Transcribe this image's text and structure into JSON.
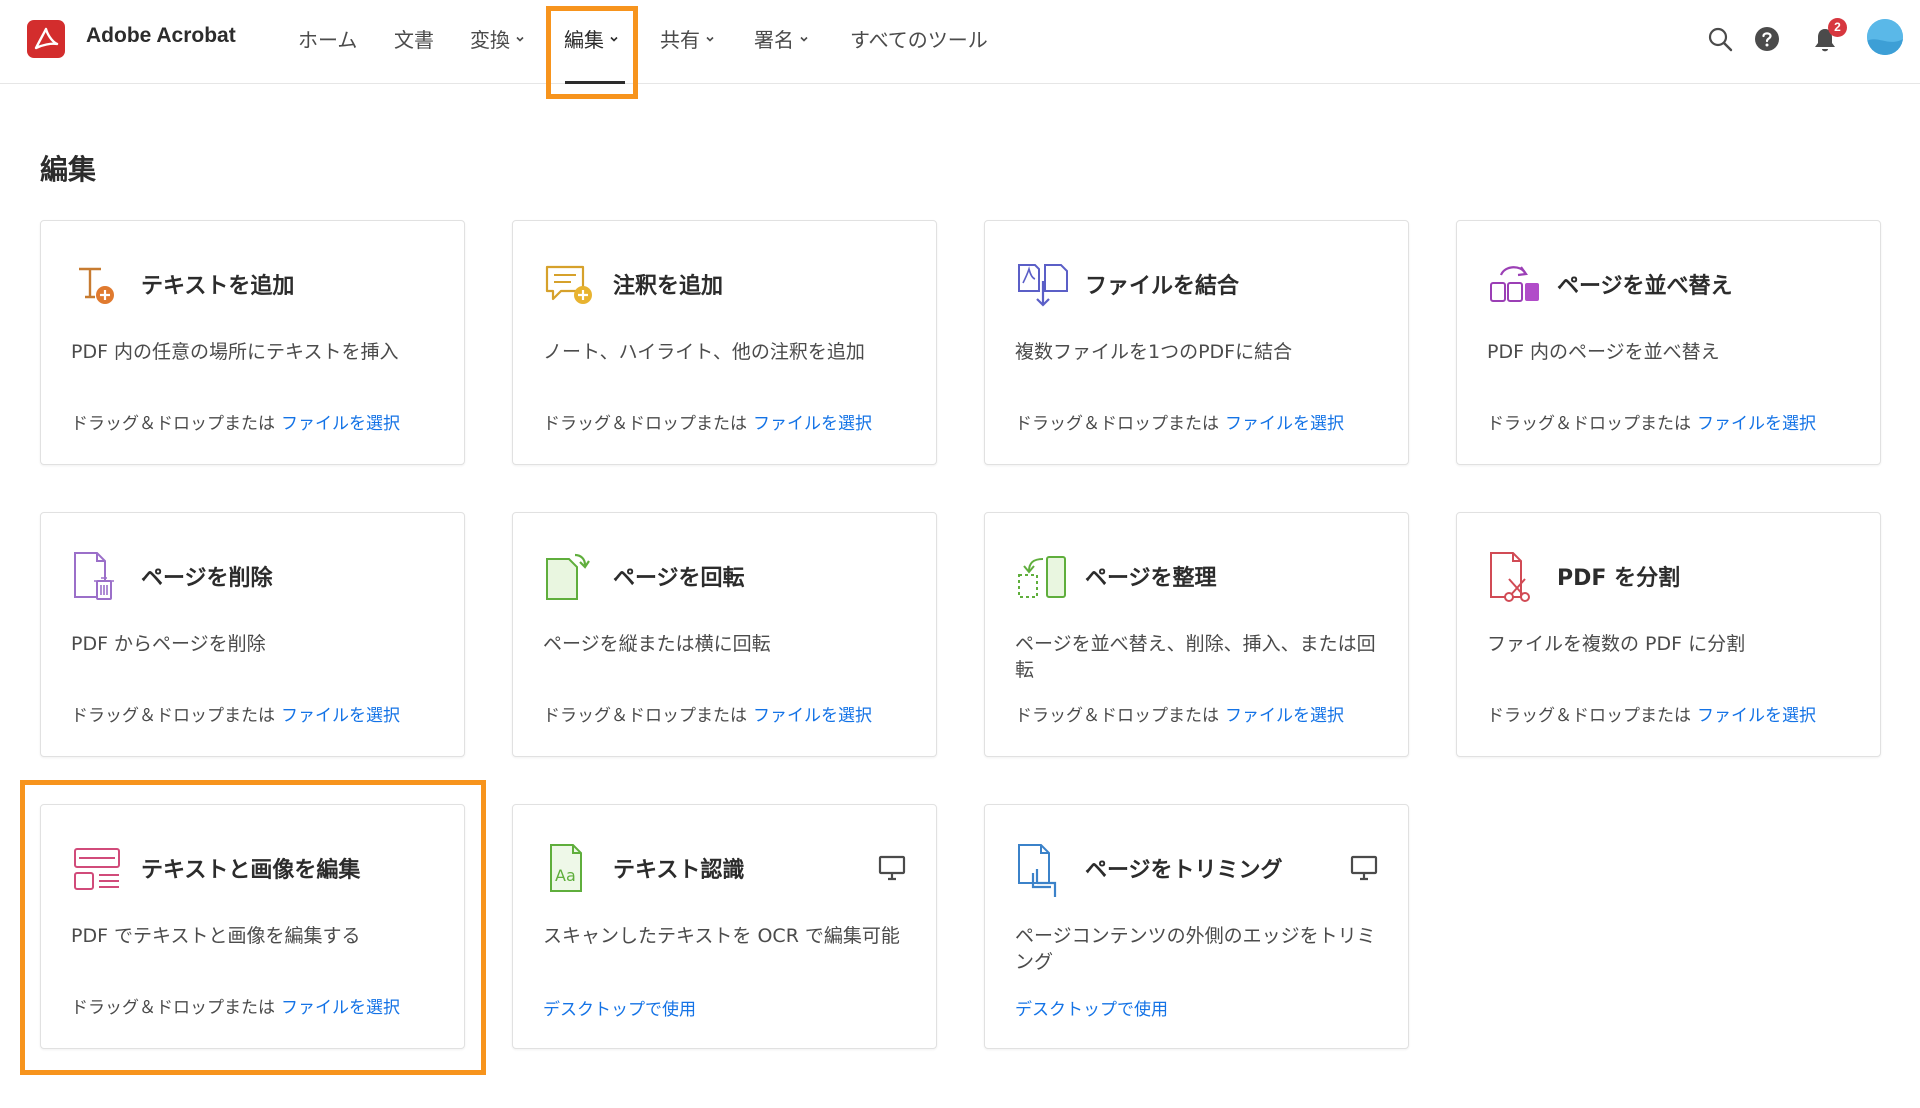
{
  "header": {
    "app_name": "Adobe Acrobat",
    "nav": [
      {
        "label": "ホーム",
        "dropdown": false
      },
      {
        "label": "文書",
        "dropdown": false
      },
      {
        "label": "変換",
        "dropdown": true
      },
      {
        "label": "編集",
        "dropdown": true,
        "active": true
      },
      {
        "label": "共有",
        "dropdown": true
      },
      {
        "label": "署名",
        "dropdown": true
      },
      {
        "label": "すべてのツール",
        "dropdown": false
      }
    ],
    "notification_count": "2"
  },
  "page": {
    "title": "編集",
    "drag_text": "ドラッグ＆ドロップまたは",
    "select_file": "ファイルを選択",
    "desktop_text": "デスクトップで使用"
  },
  "cards": [
    {
      "title": "テキストを追加",
      "desc": "PDF 内の任意の場所にテキストを挿入",
      "icon": "add-text-icon"
    },
    {
      "title": "注釈を追加",
      "desc": "ノート、ハイライト、他の注釈を追加",
      "icon": "add-comment-icon"
    },
    {
      "title": "ファイルを結合",
      "desc": "複数ファイルを1つのPDFに結合",
      "icon": "combine-files-icon"
    },
    {
      "title": "ページを並べ替え",
      "desc": "PDF 内のページを並べ替え",
      "icon": "reorder-pages-icon"
    },
    {
      "title": "ページを削除",
      "desc": "PDF からページを削除",
      "icon": "delete-pages-icon"
    },
    {
      "title": "ページを回転",
      "desc": "ページを縦または横に回転",
      "icon": "rotate-pages-icon"
    },
    {
      "title": "ページを整理",
      "desc": "ページを並べ替え、削除、挿入、または回転",
      "icon": "organize-pages-icon"
    },
    {
      "title": "PDF を分割",
      "desc": "ファイルを複数の PDF に分割",
      "icon": "split-pdf-icon"
    },
    {
      "title": "テキストと画像を編集",
      "desc": "PDF でテキストと画像を編集する",
      "icon": "edit-text-images-icon",
      "highlighted": true
    },
    {
      "title": "テキスト認識",
      "desc": "スキャンしたテキストを OCR で編集可能",
      "icon": "ocr-icon",
      "desktop": true
    },
    {
      "title": "ページをトリミング",
      "desc": "ページコンテンツの外側のエッジをトリミング",
      "icon": "crop-pages-icon",
      "desktop": true
    }
  ],
  "colors": {
    "accent_link": "#1473e6",
    "highlight_orange": "#f7941d",
    "acrobat_red": "#d32d2d"
  }
}
